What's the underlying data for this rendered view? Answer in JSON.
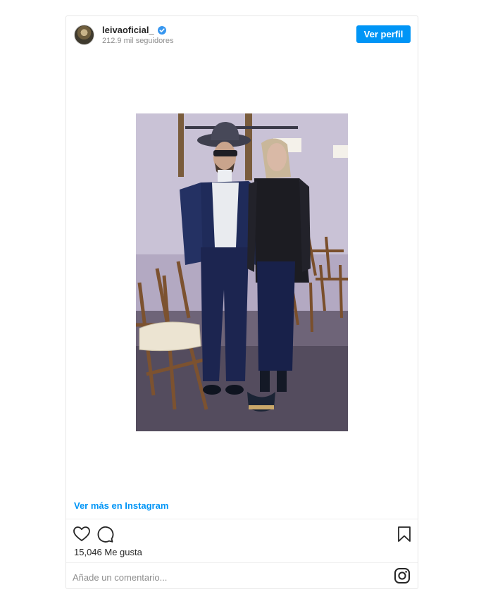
{
  "post": {
    "username": "leivaoficial_",
    "followers": "212.9 mil seguidores",
    "profile_button": "Ver perfil",
    "more_link": "Ver más en Instagram",
    "likes": "15,046 Me gusta",
    "comment_placeholder": "Añade un comentario..."
  },
  "icons": {
    "verified": "verified-badge-icon",
    "like": "heart-icon",
    "comment": "comment-icon",
    "save": "bookmark-icon",
    "brand": "instagram-icon"
  },
  "colors": {
    "accent": "#0095f6",
    "text": "#262626",
    "muted": "#8e8e8e"
  }
}
